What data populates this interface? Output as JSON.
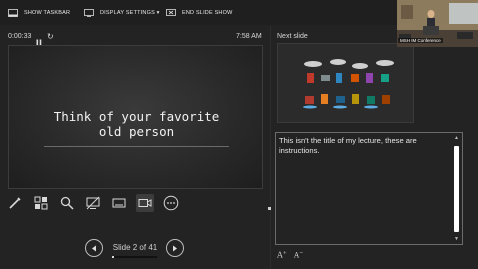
{
  "toolbar": {
    "show_taskbar": "SHOW TASKBAR",
    "display_settings": "DISPLAY SETTINGS ▾",
    "end_slide_show": "END SLIDE SHOW"
  },
  "timer": {
    "elapsed": "0:00:33"
  },
  "clock": "7:58 AM",
  "slide": {
    "title_line1": "Think of your favorite",
    "title_line2": "old person"
  },
  "navigation": {
    "counter": "Slide 2 of 41",
    "progress_fraction": 0.049
  },
  "next_slide": {
    "label": "Next slide"
  },
  "notes": {
    "text": "This isn't the title of my lecture, these are instructions."
  },
  "font_controls": {
    "increase": "A",
    "decrease": "A"
  },
  "webcam": {
    "caption": "MSH IM Conference"
  },
  "icons": {
    "toolbar": [
      "taskbar-icon",
      "display-settings-icon",
      "end-show-icon"
    ],
    "tools": [
      "pen-icon",
      "see-all-slides-icon",
      "zoom-icon",
      "black-screen-icon",
      "subtitles-icon",
      "camera-icon",
      "more-options-icon"
    ]
  },
  "colors": {
    "background": "#232323",
    "text": "#e6e6e6",
    "slide": "#2a2a2a"
  }
}
